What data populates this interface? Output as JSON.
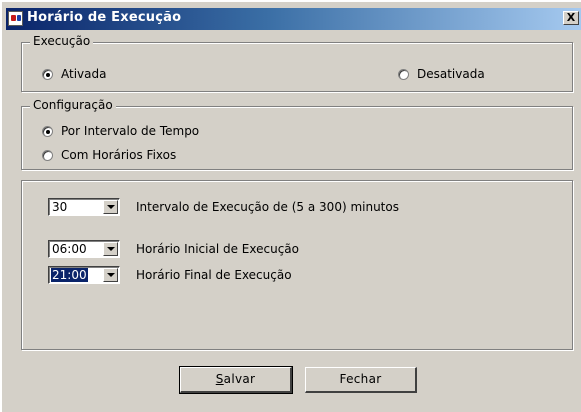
{
  "window": {
    "title": "Horário de Execução",
    "close_label": "X"
  },
  "execucao": {
    "legend": "Execução",
    "option_on": "Ativada",
    "option_off": "Desativada",
    "selected": "Ativada"
  },
  "configuracao": {
    "legend": "Configuração",
    "option_interval": "Por Intervalo de Tempo",
    "option_fixed": "Com Horários Fixos",
    "selected": "Por Intervalo de Tempo"
  },
  "settings": {
    "interval_value": "30",
    "interval_label": "Intervalo de Execução de (5 a 300) minutos",
    "start_value": "06:00",
    "start_label": "Horário Inicial de Execução",
    "end_value": "21:00",
    "end_label": "Horário Final de Execução"
  },
  "buttons": {
    "save_mnemonic": "S",
    "save_rest": "alvar",
    "close": "Fechar"
  }
}
